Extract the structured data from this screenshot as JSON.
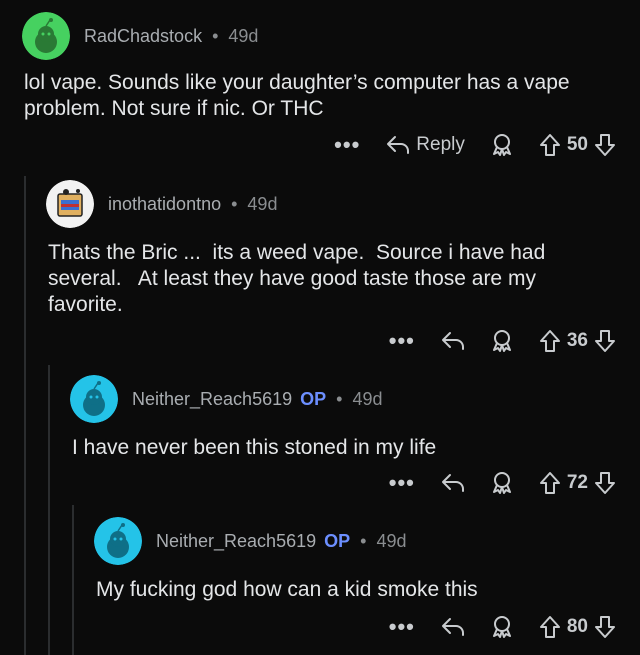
{
  "colors": {
    "background": "#0b0b0b",
    "op_badge": "#6c8fff",
    "thread_line": "#2b2d2f"
  },
  "comments": [
    {
      "username": "RadChadstock",
      "op": "",
      "age": "49d",
      "text": "lol vape. Sounds like your daughter’s computer has a vape problem. Not sure if nic. Or THC",
      "reply_label": "Reply",
      "votes": "50"
    },
    {
      "username": "inothatidontno",
      "op": "",
      "age": "49d",
      "text": "Thats the Bric ...  its a weed vape.  Source i have had several.   At least they have good taste those are my favorite.",
      "reply_label": "",
      "votes": "36"
    },
    {
      "username": "Neither_Reach5619",
      "op": "OP",
      "age": "49d",
      "text": "I have never been this stoned in my life",
      "reply_label": "",
      "votes": "72"
    },
    {
      "username": "Neither_Reach5619",
      "op": "OP",
      "age": "49d",
      "text": "My fucking god how can a kid smoke this",
      "reply_label": "",
      "votes": "80"
    }
  ],
  "separator": "•",
  "more_glyph": "•••"
}
